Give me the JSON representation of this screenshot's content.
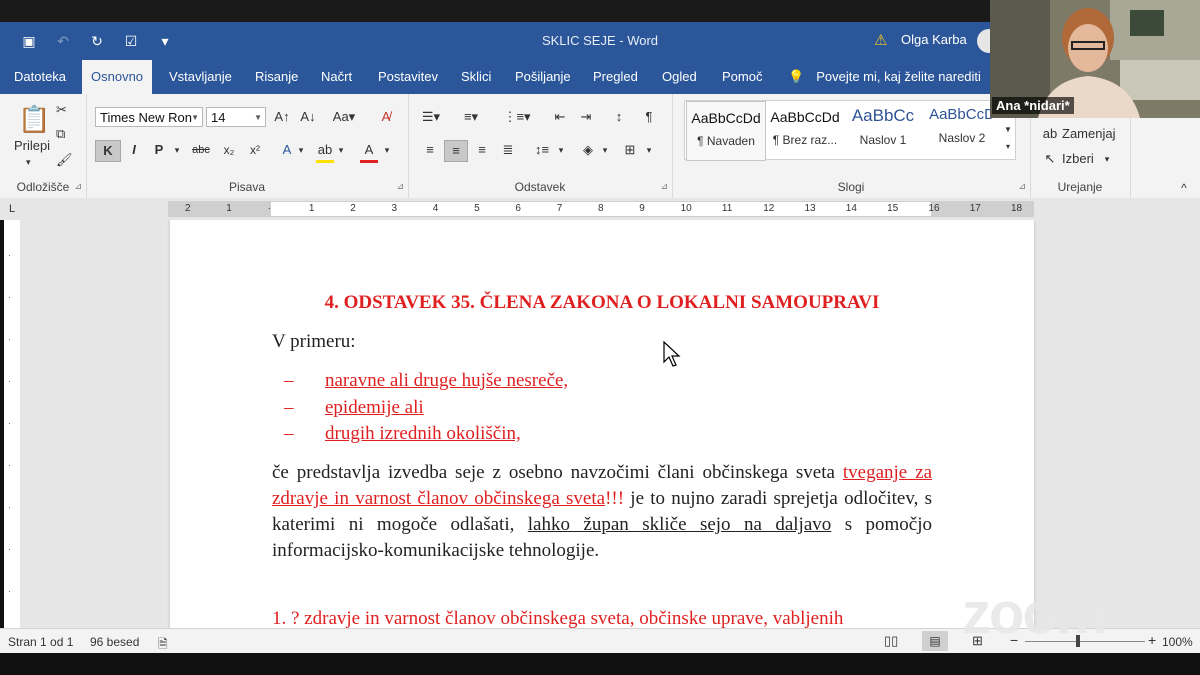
{
  "window": {
    "title": "SKLIC SEJE  -  Word",
    "user": "Olga Karba"
  },
  "tabs": [
    "Datoteka",
    "Osnovno",
    "Vstavljanje",
    "Risanje",
    "Načrt",
    "Postavitev",
    "Sklici",
    "Pošiljanje",
    "Pregled",
    "Ogled",
    "Pomoč"
  ],
  "tell_me": "Povejte mi, kaj želite narediti",
  "ribbon": {
    "clipboard": {
      "paste_label": "Prilepi",
      "group": "Odložišče"
    },
    "font": {
      "name": "Times New Ron",
      "size": "14",
      "bold": "K",
      "italic": "I",
      "underline": "P",
      "group": "Pisava"
    },
    "paragraph": {
      "group": "Odstavek"
    },
    "styles": {
      "items": [
        {
          "preview": "AaBbCcDd",
          "name": "¶ Navaden"
        },
        {
          "preview": "AaBbCcDd",
          "name": "¶ Brez raz..."
        },
        {
          "preview": "AaBbCc",
          "name": "Naslov 1"
        },
        {
          "preview": "AaBbCcD",
          "name": "Naslov 2"
        }
      ],
      "group": "Slogi"
    },
    "editing": {
      "replace": "Zamenjaj",
      "select": "Izberi",
      "group": "Urejanje"
    }
  },
  "ruler": {
    "labels": [
      "2",
      "1",
      "",
      "1",
      "2",
      "3",
      "4",
      "5",
      "6",
      "7",
      "8",
      "9",
      "10",
      "11",
      "12",
      "13",
      "14",
      "15",
      "16",
      "17",
      "18"
    ]
  },
  "document": {
    "heading": "4. ODSTAVEK 35. ČLENA ZAKONA O LOKALNI SAMOUPRAVI",
    "intro": "V primeru:",
    "bullets": [
      "naravne ali druge hujše nesreče,",
      "epidemije ali",
      "drugih izrednih okoliščin,"
    ],
    "bullet_dash": "–",
    "para": {
      "p1": "če predstavlja izvedba seje z osebno navzočimi člani občinskega sveta ",
      "red_ul": "tveganje za zdravje in varnost članov občinskega sveta",
      "red_excl": "!!!",
      "p2": " je to nujno zaradi sprejetja odločitev, s katerimi ni mogoče odlašati, ",
      "ul": "lahko župan skliče sejo na daljavo",
      "p3": " s pomočjo informacijsko-komunikacijske tehnologije."
    },
    "item1": "1.  ? zdravje in varnost članov občinskega sveta, občinske uprave, vabljenih"
  },
  "status": {
    "page": "Stran 1 od 1",
    "words": "96 besed",
    "zoom": "100%"
  },
  "video": {
    "name": "Ana *nidari*"
  },
  "watermark": "zoom"
}
